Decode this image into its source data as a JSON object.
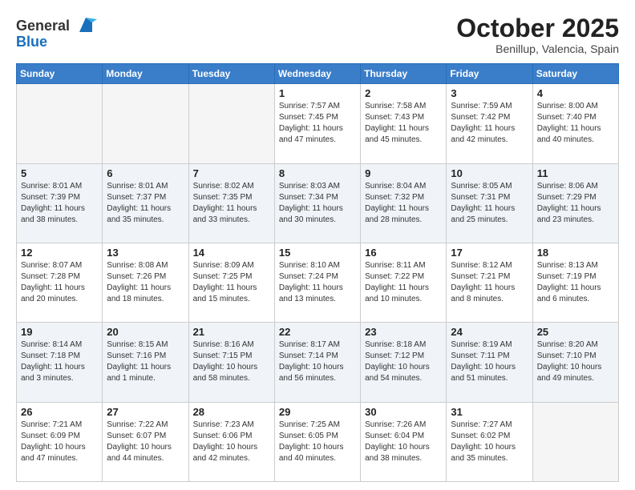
{
  "header": {
    "logo_line1": "General",
    "logo_line2": "Blue",
    "month": "October 2025",
    "location": "Benillup, Valencia, Spain"
  },
  "weekdays": [
    "Sunday",
    "Monday",
    "Tuesday",
    "Wednesday",
    "Thursday",
    "Friday",
    "Saturday"
  ],
  "weeks": [
    [
      {
        "day": "",
        "info": ""
      },
      {
        "day": "",
        "info": ""
      },
      {
        "day": "",
        "info": ""
      },
      {
        "day": "1",
        "info": "Sunrise: 7:57 AM\nSunset: 7:45 PM\nDaylight: 11 hours\nand 47 minutes."
      },
      {
        "day": "2",
        "info": "Sunrise: 7:58 AM\nSunset: 7:43 PM\nDaylight: 11 hours\nand 45 minutes."
      },
      {
        "day": "3",
        "info": "Sunrise: 7:59 AM\nSunset: 7:42 PM\nDaylight: 11 hours\nand 42 minutes."
      },
      {
        "day": "4",
        "info": "Sunrise: 8:00 AM\nSunset: 7:40 PM\nDaylight: 11 hours\nand 40 minutes."
      }
    ],
    [
      {
        "day": "5",
        "info": "Sunrise: 8:01 AM\nSunset: 7:39 PM\nDaylight: 11 hours\nand 38 minutes."
      },
      {
        "day": "6",
        "info": "Sunrise: 8:01 AM\nSunset: 7:37 PM\nDaylight: 11 hours\nand 35 minutes."
      },
      {
        "day": "7",
        "info": "Sunrise: 8:02 AM\nSunset: 7:35 PM\nDaylight: 11 hours\nand 33 minutes."
      },
      {
        "day": "8",
        "info": "Sunrise: 8:03 AM\nSunset: 7:34 PM\nDaylight: 11 hours\nand 30 minutes."
      },
      {
        "day": "9",
        "info": "Sunrise: 8:04 AM\nSunset: 7:32 PM\nDaylight: 11 hours\nand 28 minutes."
      },
      {
        "day": "10",
        "info": "Sunrise: 8:05 AM\nSunset: 7:31 PM\nDaylight: 11 hours\nand 25 minutes."
      },
      {
        "day": "11",
        "info": "Sunrise: 8:06 AM\nSunset: 7:29 PM\nDaylight: 11 hours\nand 23 minutes."
      }
    ],
    [
      {
        "day": "12",
        "info": "Sunrise: 8:07 AM\nSunset: 7:28 PM\nDaylight: 11 hours\nand 20 minutes."
      },
      {
        "day": "13",
        "info": "Sunrise: 8:08 AM\nSunset: 7:26 PM\nDaylight: 11 hours\nand 18 minutes."
      },
      {
        "day": "14",
        "info": "Sunrise: 8:09 AM\nSunset: 7:25 PM\nDaylight: 11 hours\nand 15 minutes."
      },
      {
        "day": "15",
        "info": "Sunrise: 8:10 AM\nSunset: 7:24 PM\nDaylight: 11 hours\nand 13 minutes."
      },
      {
        "day": "16",
        "info": "Sunrise: 8:11 AM\nSunset: 7:22 PM\nDaylight: 11 hours\nand 10 minutes."
      },
      {
        "day": "17",
        "info": "Sunrise: 8:12 AM\nSunset: 7:21 PM\nDaylight: 11 hours\nand 8 minutes."
      },
      {
        "day": "18",
        "info": "Sunrise: 8:13 AM\nSunset: 7:19 PM\nDaylight: 11 hours\nand 6 minutes."
      }
    ],
    [
      {
        "day": "19",
        "info": "Sunrise: 8:14 AM\nSunset: 7:18 PM\nDaylight: 11 hours\nand 3 minutes."
      },
      {
        "day": "20",
        "info": "Sunrise: 8:15 AM\nSunset: 7:16 PM\nDaylight: 11 hours\nand 1 minute."
      },
      {
        "day": "21",
        "info": "Sunrise: 8:16 AM\nSunset: 7:15 PM\nDaylight: 10 hours\nand 58 minutes."
      },
      {
        "day": "22",
        "info": "Sunrise: 8:17 AM\nSunset: 7:14 PM\nDaylight: 10 hours\nand 56 minutes."
      },
      {
        "day": "23",
        "info": "Sunrise: 8:18 AM\nSunset: 7:12 PM\nDaylight: 10 hours\nand 54 minutes."
      },
      {
        "day": "24",
        "info": "Sunrise: 8:19 AM\nSunset: 7:11 PM\nDaylight: 10 hours\nand 51 minutes."
      },
      {
        "day": "25",
        "info": "Sunrise: 8:20 AM\nSunset: 7:10 PM\nDaylight: 10 hours\nand 49 minutes."
      }
    ],
    [
      {
        "day": "26",
        "info": "Sunrise: 7:21 AM\nSunset: 6:09 PM\nDaylight: 10 hours\nand 47 minutes."
      },
      {
        "day": "27",
        "info": "Sunrise: 7:22 AM\nSunset: 6:07 PM\nDaylight: 10 hours\nand 44 minutes."
      },
      {
        "day": "28",
        "info": "Sunrise: 7:23 AM\nSunset: 6:06 PM\nDaylight: 10 hours\nand 42 minutes."
      },
      {
        "day": "29",
        "info": "Sunrise: 7:25 AM\nSunset: 6:05 PM\nDaylight: 10 hours\nand 40 minutes."
      },
      {
        "day": "30",
        "info": "Sunrise: 7:26 AM\nSunset: 6:04 PM\nDaylight: 10 hours\nand 38 minutes."
      },
      {
        "day": "31",
        "info": "Sunrise: 7:27 AM\nSunset: 6:02 PM\nDaylight: 10 hours\nand 35 minutes."
      },
      {
        "day": "",
        "info": ""
      }
    ]
  ]
}
